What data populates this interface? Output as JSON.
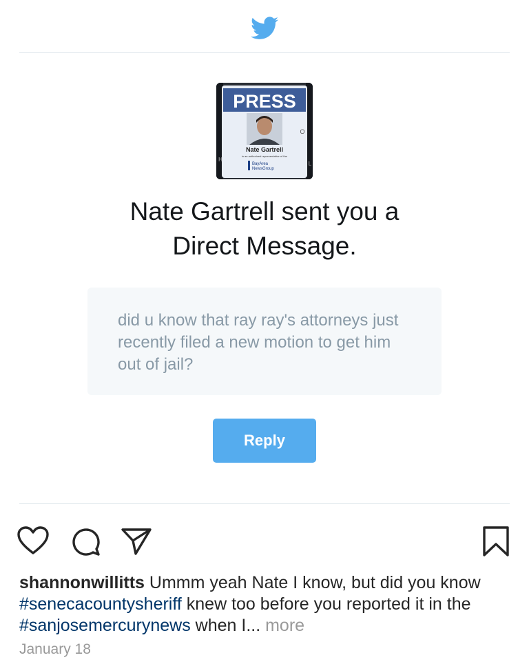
{
  "header": {
    "icon": "twitter-bird-icon",
    "brand_color": "#55acee"
  },
  "notification": {
    "avatar": {
      "badge_title": "PRESS",
      "badge_name": "Nate Gartrell",
      "badge_subtitle": "is an authorized representative of the",
      "badge_org_line1": "BayArea",
      "badge_org_line2": "NewsGroup",
      "badge_letter_o": "O",
      "badge_letter_h": "H",
      "badge_letter_l": "L"
    },
    "headline_line1": "Nate Gartrell sent you a",
    "headline_line2": "Direct Message.",
    "message": "did u know that ray ray's attorneys just recently filed a new motion to get him out of jail?",
    "reply_label": "Reply"
  },
  "post": {
    "actions": [
      "heart-icon",
      "comment-icon",
      "share-icon",
      "bookmark-icon"
    ],
    "caption": {
      "username": "shannonwillitts",
      "text_part1": " Ummm yeah Nate I know, but did you know ",
      "hashtag1": "#senecacountysheriff",
      "text_part2": " knew too before you reported it in the ",
      "hashtag2": "#sanjosemercurynews",
      "text_part3": " when I... ",
      "more_label": "more"
    },
    "date": "January 18"
  }
}
